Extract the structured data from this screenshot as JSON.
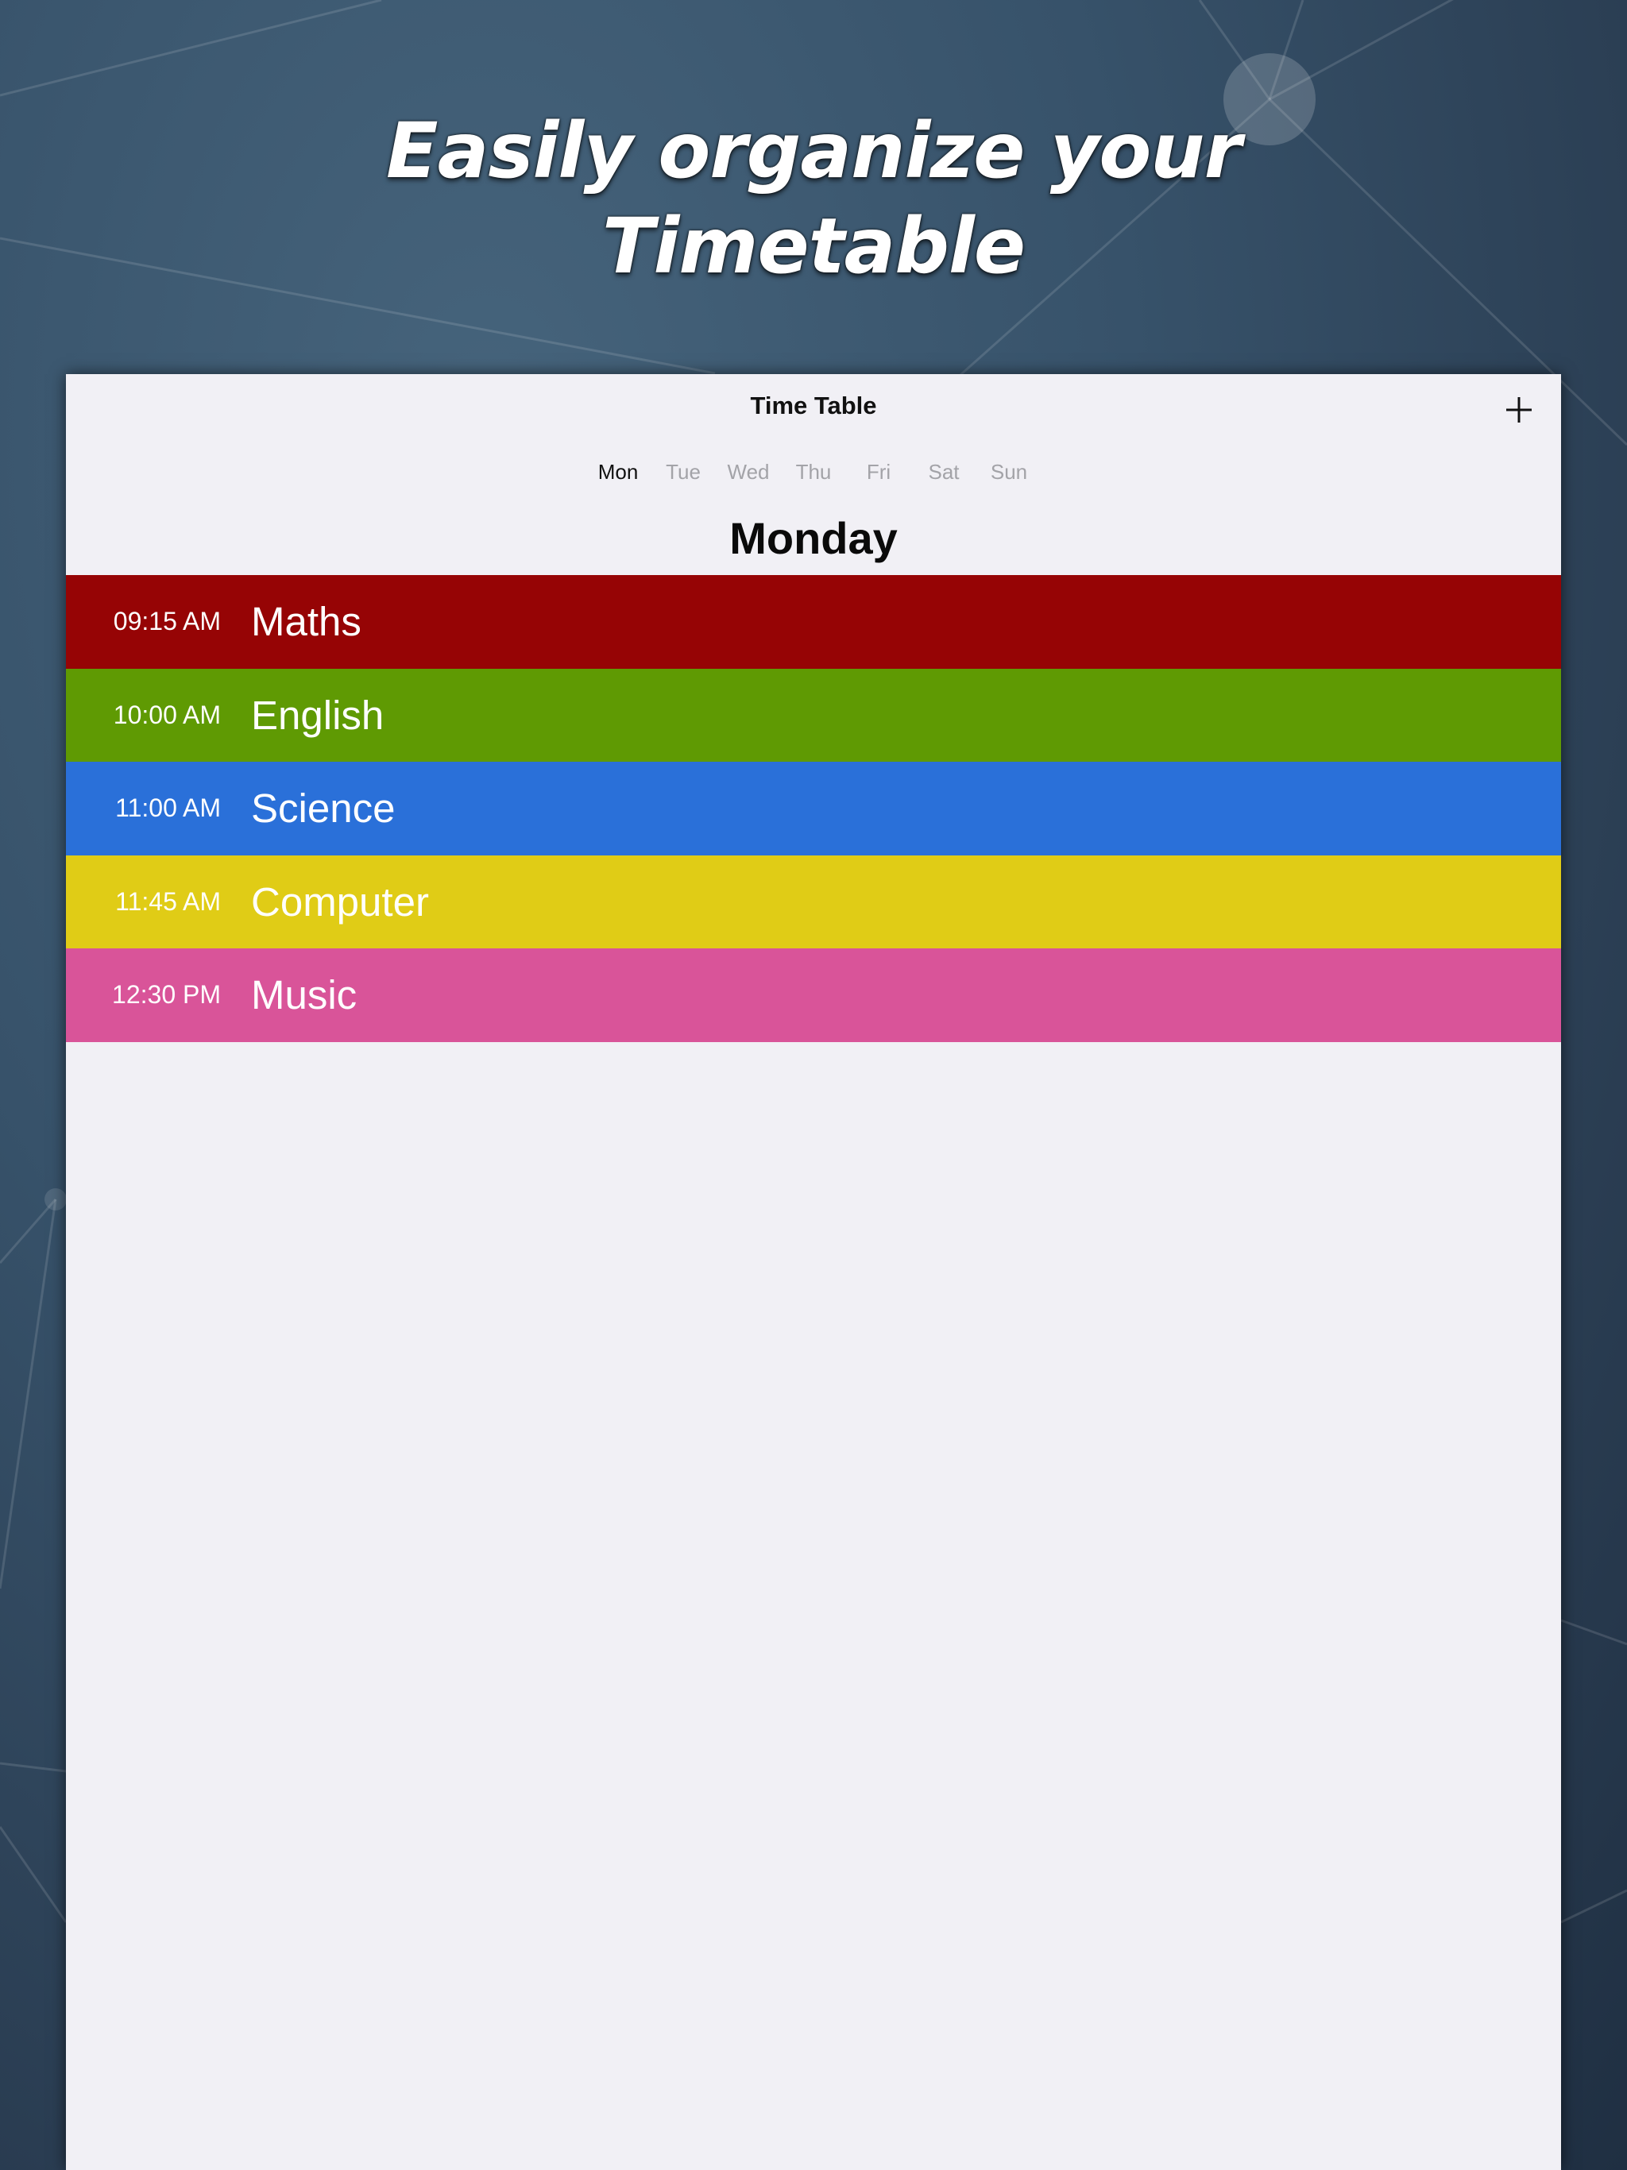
{
  "promo": {
    "line1": "Easily organize your",
    "line2": "Timetable"
  },
  "nav": {
    "title": "Time Table",
    "add_icon": "plus-icon"
  },
  "days": [
    "Mon",
    "Tue",
    "Wed",
    "Thu",
    "Fri",
    "Sat",
    "Sun"
  ],
  "selected_day_index": 0,
  "day_heading": "Monday",
  "classes": [
    {
      "time": "09:15 AM",
      "subject": "Maths",
      "color": "#960405"
    },
    {
      "time": "10:00 AM",
      "subject": "English",
      "color": "#5f9a03"
    },
    {
      "time": "11:00 AM",
      "subject": "Science",
      "color": "#2a70d9"
    },
    {
      "time": "11:45 AM",
      "subject": "Computer",
      "color": "#e0cc16"
    },
    {
      "time": "12:30 PM",
      "subject": "Music",
      "color": "#d95499"
    }
  ],
  "colors": {
    "background": "#37526a",
    "screen": "#f1f0f5",
    "inactive_day": "#a3a3a8",
    "active_day": "#111111"
  }
}
